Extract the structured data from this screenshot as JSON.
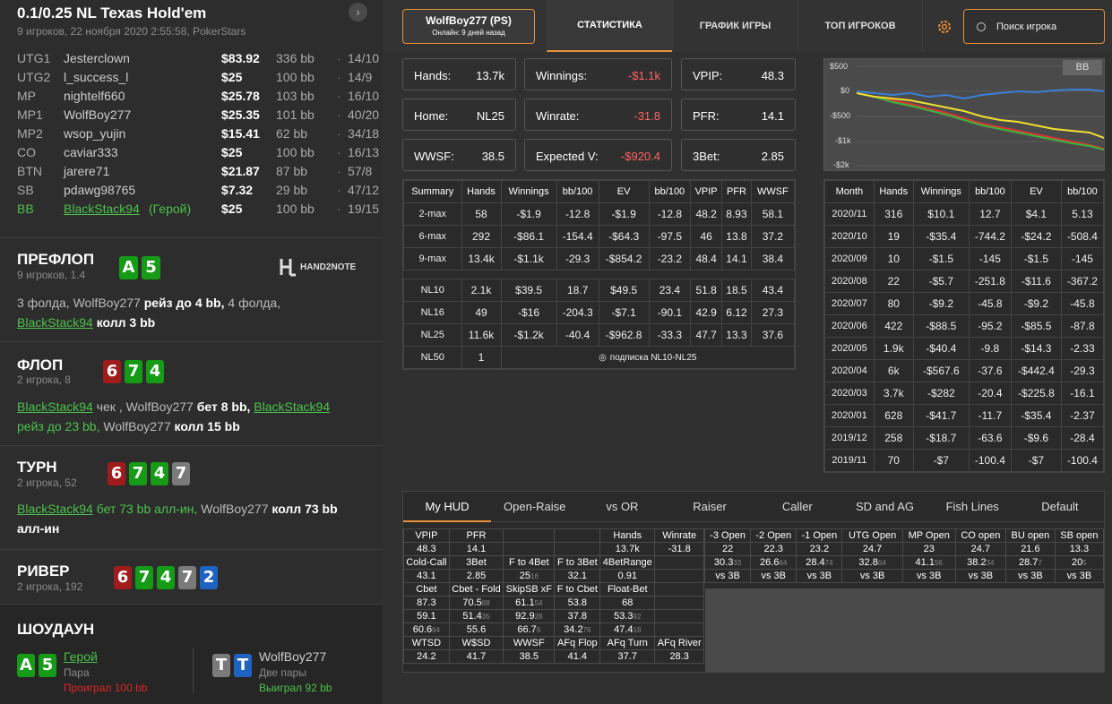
{
  "hand": {
    "title": "0.1/0.25 NL Texas Hold'em",
    "subtitle": "9 игроков, 22 ноября 2020 2:55:58, PokerStars",
    "players": [
      {
        "pos": "UTG1",
        "name": "Jesterclown",
        "stack": "$83.92",
        "bb": "336 bb",
        "ratio": "14/10"
      },
      {
        "pos": "UTG2",
        "name": "l_success_l",
        "stack": "$25",
        "bb": "100 bb",
        "ratio": "14/9"
      },
      {
        "pos": "MP",
        "name": "nightelf660",
        "stack": "$25.78",
        "bb": "103 bb",
        "ratio": "16/10"
      },
      {
        "pos": "MP1",
        "name": "WolfBoy277",
        "stack": "$25.35",
        "bb": "101 bb",
        "ratio": "40/20"
      },
      {
        "pos": "MP2",
        "name": "wsop_yujin",
        "stack": "$15.41",
        "bb": "62 bb",
        "ratio": "34/18"
      },
      {
        "pos": "CO",
        "name": "caviar333",
        "stack": "$25",
        "bb": "100 bb",
        "ratio": "16/13"
      },
      {
        "pos": "BTN",
        "name": "jarere71",
        "stack": "$21.87",
        "bb": "87 bb",
        "ratio": "57/8"
      },
      {
        "pos": "SB",
        "name": "pdawg98765",
        "stack": "$7.32",
        "bb": "29 bb",
        "ratio": "47/12"
      },
      {
        "pos": "BB",
        "name": "BlackStack94",
        "hero": "(Герой)",
        "stack": "$25",
        "bb": "100 bb",
        "ratio": "19/15"
      }
    ],
    "dot": "·",
    "preflop": {
      "title": "ПРЕФЛОП",
      "sub": "9 игроков, 1.4",
      "cards": [
        "A",
        "5"
      ],
      "logo": "HAND2NOTE",
      "a1": "3 фолда, WolfBoy277 ",
      "a2": "рейз до 4 bb,",
      "a3": " 4 фолда,",
      "a4": "BlackStack94",
      "a5": " колл 3 bb"
    },
    "flop": {
      "title": "ФЛОП",
      "sub": "2 игрока, 8",
      "cards": [
        "6",
        "7",
        "4"
      ],
      "a1": "BlackStack94",
      "a2": " чек ,",
      "a3": " WolfBoy277 ",
      "a4": "бет 8 bb,",
      "a5": "BlackStack94",
      "a6": "рейз до 23 bb,",
      "a7": " WolfBoy277 ",
      "a8": "колл 15 bb"
    },
    "turn": {
      "title": "ТУРН",
      "sub": "2 игрока, 52",
      "cards": [
        "6",
        "7",
        "4",
        "7"
      ],
      "a1": "BlackStack94",
      "a2": " бет 73 bb алл-ин,",
      "a3": " WolfBoy277 ",
      "a4": "колл 73 bb",
      "a5": "алл-ин"
    },
    "river": {
      "title": "РИВЕР",
      "sub": "2 игрока, 192",
      "cards": [
        "6",
        "7",
        "4",
        "7",
        "2"
      ]
    },
    "showdown": {
      "title": "ШОУДАУН",
      "hero_cards": [
        "A",
        "5"
      ],
      "hero_label": "Герой",
      "hero_hand": "Пара",
      "hero_result": "Проиграл 100 bb",
      "opp_cards": [
        "T",
        "T"
      ],
      "opp_name": "WolfBoy277",
      "opp_hand": "Две пары",
      "opp_result": "Выиграл 92 bb"
    }
  },
  "nav": {
    "player": "WolfBoy277 (PS)",
    "online": "Онлайн: 9 дней назад",
    "tabs": [
      "СТАТИСТИКА",
      "ГРАФИК ИГРЫ",
      "ТОП ИГРОКОВ"
    ],
    "search_placeholder": "Поиск игрока",
    "accent": "#e8903a"
  },
  "stats": {
    "hands_k": "Hands:",
    "hands_v": "13.7k",
    "win_k": "Winnings:",
    "win_v": "-$1.1k",
    "vpip_k": "VPIP:",
    "vpip_v": "48.3",
    "home_k": "Home:",
    "home_v": "NL25",
    "wr_k": "Winrate:",
    "wr_v": "-31.8",
    "pfr_k": "PFR:",
    "pfr_v": "14.1",
    "wwsf_k": "WWSF:",
    "wwsf_v": "38.5",
    "ev_k": "Expected V:",
    "ev_v": "-$920.4",
    "tb_k": "3Bet:",
    "tb_v": "2.85"
  },
  "graph": {
    "badge": "BB",
    "y": [
      "$500",
      "$0",
      "-$500",
      "-$1k",
      "-$2k"
    ]
  },
  "summary": {
    "headers": [
      "Summary",
      "Hands",
      "Winnings",
      "bb/100",
      "EV",
      "bb/100",
      "VPIP",
      "PFR",
      "WWSF"
    ],
    "rows": [
      [
        "2-max",
        "58",
        "-$1.9",
        "-12.8",
        "-$1.9",
        "-12.8",
        "48.2",
        "8.93",
        "58.1"
      ],
      [
        "6-max",
        "292",
        "-$86.1",
        "-154.4",
        "-$64.3",
        "-97.5",
        "46",
        "13.8",
        "37.2"
      ],
      [
        "9-max",
        "13.4k",
        "-$1.1k",
        "-29.3",
        "-$854.2",
        "-23.2",
        "48.4",
        "14.1",
        "38.4"
      ]
    ],
    "rows2": [
      [
        "NL10",
        "2.1k",
        "$39.5",
        "18.7",
        "$49.5",
        "23.4",
        "51.8",
        "18.5",
        "43.4"
      ],
      [
        "NL16",
        "49",
        "-$16",
        "-204.3",
        "-$7.1",
        "-90.1",
        "42.9",
        "6.12",
        "27.3"
      ],
      [
        "NL25",
        "11.6k",
        "-$1.2k",
        "-40.4",
        "-$962.8",
        "-33.3",
        "47.7",
        "13.3",
        "37.6"
      ]
    ],
    "nl50": [
      "NL50",
      "1"
    ],
    "sub_note": "подписка NL10-NL25"
  },
  "months": {
    "headers": [
      "Month",
      "Hands",
      "Winnings",
      "bb/100",
      "EV",
      "bb/100"
    ],
    "rows": [
      [
        "2020/11",
        "316",
        "$10.1",
        "12.7",
        "$4.1",
        "5.13"
      ],
      [
        "2020/10",
        "19",
        "-$35.4",
        "-744.2",
        "-$24.2",
        "-508.4"
      ],
      [
        "2020/09",
        "10",
        "-$1.5",
        "-145",
        "-$1.5",
        "-145"
      ],
      [
        "2020/08",
        "22",
        "-$5.7",
        "-251.8",
        "-$11.6",
        "-367.2"
      ],
      [
        "2020/07",
        "80",
        "-$9.2",
        "-45.8",
        "-$9.2",
        "-45.8"
      ],
      [
        "2020/06",
        "422",
        "-$88.5",
        "-95.2",
        "-$85.5",
        "-87.8"
      ],
      [
        "2020/05",
        "1.9k",
        "-$40.4",
        "-9.8",
        "-$14.3",
        "-2.33"
      ],
      [
        "2020/04",
        "6k",
        "-$567.6",
        "-37.6",
        "-$442.4",
        "-29.3"
      ],
      [
        "2020/03",
        "3.7k",
        "-$282",
        "-20.4",
        "-$225.8",
        "-16.1"
      ],
      [
        "2020/01",
        "628",
        "-$41.7",
        "-11.7",
        "-$35.4",
        "-2.37"
      ],
      [
        "2019/12",
        "258",
        "-$18.7",
        "-63.6",
        "-$9.6",
        "-28.4"
      ],
      [
        "2019/11",
        "70",
        "-$7",
        "-100.4",
        "-$7",
        "-100.4"
      ]
    ]
  },
  "hud": {
    "tabs": [
      "My HUD",
      "Open-Raise",
      "vs OR",
      "Raiser",
      "Caller",
      "SD and AG",
      "Fish Lines",
      "Default"
    ],
    "h1": [
      "VPIP",
      "PFR",
      "",
      "",
      "Hands",
      "Winrate"
    ],
    "v1": [
      "48.3",
      "14.1",
      "",
      "",
      "13.7k",
      "-31.8"
    ],
    "h2": [
      "Cold-Call",
      "3Bet",
      "F to 4Bet",
      "F to 3Bet",
      "4BetRange"
    ],
    "v2": [
      "43.1",
      "2.85",
      "25",
      "32.1",
      "0.91"
    ],
    "v2s": [
      "",
      "",
      "16",
      "",
      ""
    ],
    "h3": [
      "Cbet",
      "Cbet - Fold",
      "SkipSB xF",
      "F to Cbet",
      "Float-Bet"
    ],
    "r4": [
      "87.3",
      "70.5",
      "61.1",
      "53.8",
      "68"
    ],
    "r4s": [
      "",
      "88",
      "54",
      "",
      ""
    ],
    "r5": [
      "59.1",
      "51.4",
      "92.9",
      "37.8",
      "53.3"
    ],
    "r5s": [
      "",
      "35",
      "28",
      "",
      "92"
    ],
    "r6": [
      "60.6",
      "55.6",
      "66.7",
      "34.2",
      "47.4"
    ],
    "r6s": [
      "94",
      "",
      "6",
      "76",
      "18"
    ],
    "h7": [
      "WTSD",
      "W$SD",
      "WWSF",
      "AFq Flop",
      "AFq Turn",
      "AFq River"
    ],
    "v7": [
      "24.2",
      "41.7",
      "38.5",
      "41.4",
      "37.7",
      "28.3"
    ],
    "oh": [
      "-3 Open",
      "-2 Open",
      "-1 Open",
      "UTG Open",
      "MP Open",
      "CO open",
      "BU open",
      "SB open"
    ],
    "ov": [
      "22",
      "22.3",
      "23.2",
      "24.7",
      "23",
      "24.7",
      "21.6",
      "13.3"
    ],
    "ov2": [
      "30.3",
      "26.6",
      "28.4",
      "32.8",
      "41.1",
      "38.2",
      "28.7",
      "20"
    ],
    "ov2s": [
      "33",
      "64",
      "74",
      "64",
      "56",
      "34",
      "7",
      "5"
    ],
    "vs3b": "vs 3B"
  }
}
